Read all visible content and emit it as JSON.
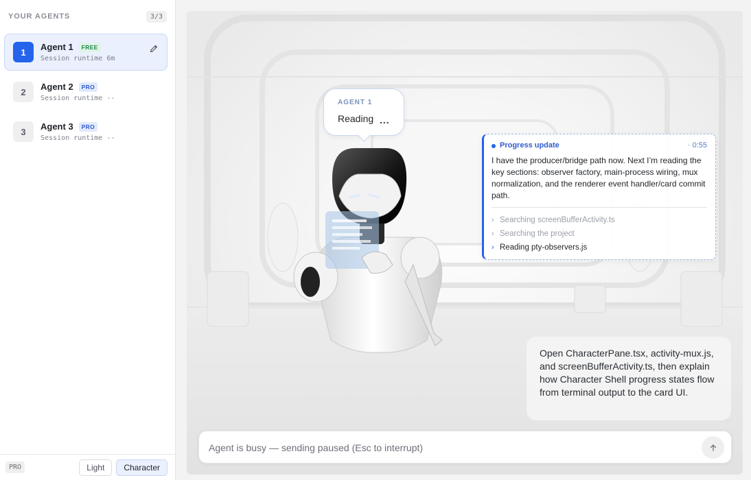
{
  "sidebar": {
    "title": "YOUR AGENTS",
    "count": "3/3",
    "agents": [
      {
        "number": "1",
        "name": "Agent 1",
        "badge": "FREE",
        "runtime": "Session runtime 6m"
      },
      {
        "number": "2",
        "name": "Agent 2",
        "badge": "PRO",
        "runtime": "Session runtime --"
      },
      {
        "number": "3",
        "name": "Agent 3",
        "badge": "PRO",
        "runtime": "Session runtime --"
      }
    ],
    "active_agent": "Agent 1",
    "footer": {
      "plan": "PRO",
      "modes": [
        "Light",
        "Character"
      ],
      "selected_mode": "Character"
    }
  },
  "scene": {
    "bubble": {
      "label": "AGENT 1",
      "status": "Reading",
      "dots": "..."
    },
    "progress": {
      "title": "Progress update",
      "time": "· 0:55",
      "body": "I have the producer/bridge path now. Next I’m reading the key sections: observer factory, main-process wiring, mux normalization, and the renderer event handler/card commit path.",
      "steps": [
        {
          "text": "Searching screenBufferActivity.ts",
          "state": "done"
        },
        {
          "text": "Searching the project",
          "state": "done"
        },
        {
          "text": "Reading pty-observers.js",
          "state": "current"
        }
      ]
    },
    "prompt": "Open CharacterPane.tsx, activity-mux.js, and screenBufferActivity.ts, then explain how Character Shell progress states flow from terminal output to the card UI."
  },
  "input": {
    "placeholder": "Agent is busy — sending paused (Esc to interrupt)",
    "value": ""
  },
  "icons": {
    "edit": "pencil-icon",
    "send": "arrow-up-icon",
    "chevron": "chevron-right-icon"
  },
  "colors": {
    "accent": "#2563eb",
    "free_badge": "#1f8a4c",
    "pro_badge": "#2f5bd0"
  }
}
